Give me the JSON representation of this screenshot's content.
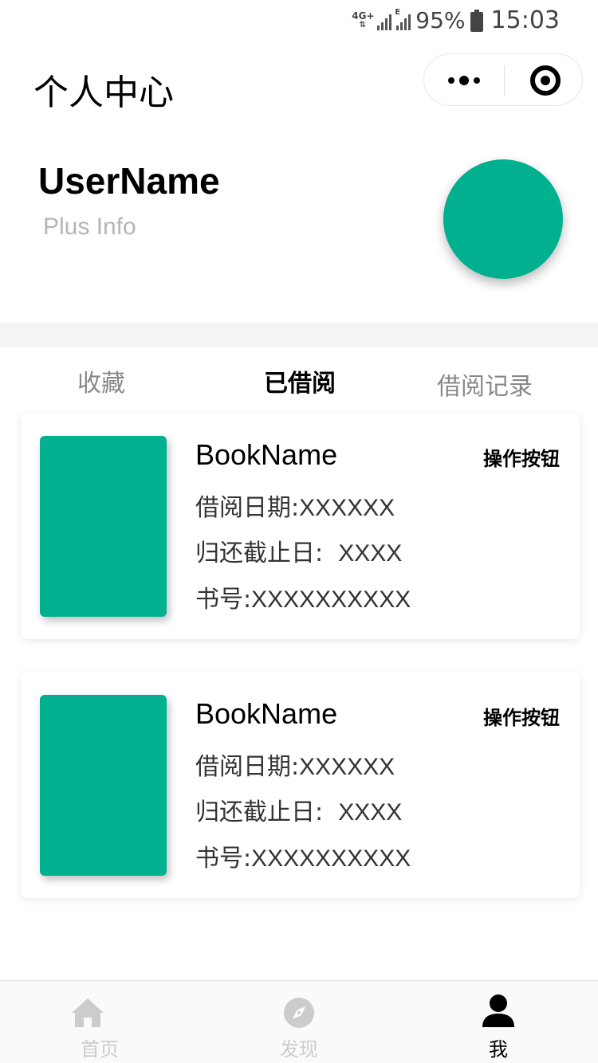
{
  "status_bar": {
    "network": "4G+",
    "network_e": "E",
    "battery": "95%",
    "time": "15:03"
  },
  "nav": {
    "title": "个人中心"
  },
  "profile": {
    "username": "UserName",
    "plus_info": "Plus Info"
  },
  "tabs": [
    {
      "label": "收藏",
      "active": false
    },
    {
      "label": "已借阅",
      "active": true
    },
    {
      "label": "借阅记录",
      "active": false
    }
  ],
  "books": [
    {
      "name": "BookName",
      "action": "操作按钮",
      "borrow_date_label": "借阅日期:",
      "borrow_date_value": "XXXXXX",
      "due_date_label": "归还截止日:",
      "due_date_value": "XXXX",
      "book_no_label": "书号:",
      "book_no_value": "XXXXXXXXXX"
    },
    {
      "name": "BookName",
      "action": "操作按钮",
      "borrow_date_label": "借阅日期:",
      "borrow_date_value": "XXXXXX",
      "due_date_label": "归还截止日:",
      "due_date_value": "XXXX",
      "book_no_label": "书号:",
      "book_no_value": "XXXXXXXXXX"
    }
  ],
  "tabbar": [
    {
      "label": "首页",
      "icon": "home-icon",
      "active": false
    },
    {
      "label": "发现",
      "icon": "compass-icon",
      "active": false
    },
    {
      "label": "我",
      "icon": "person-icon",
      "active": true
    }
  ],
  "colors": {
    "accent": "#00b08f",
    "inactive": "#cccccc",
    "tab_inactive": "#888888"
  }
}
